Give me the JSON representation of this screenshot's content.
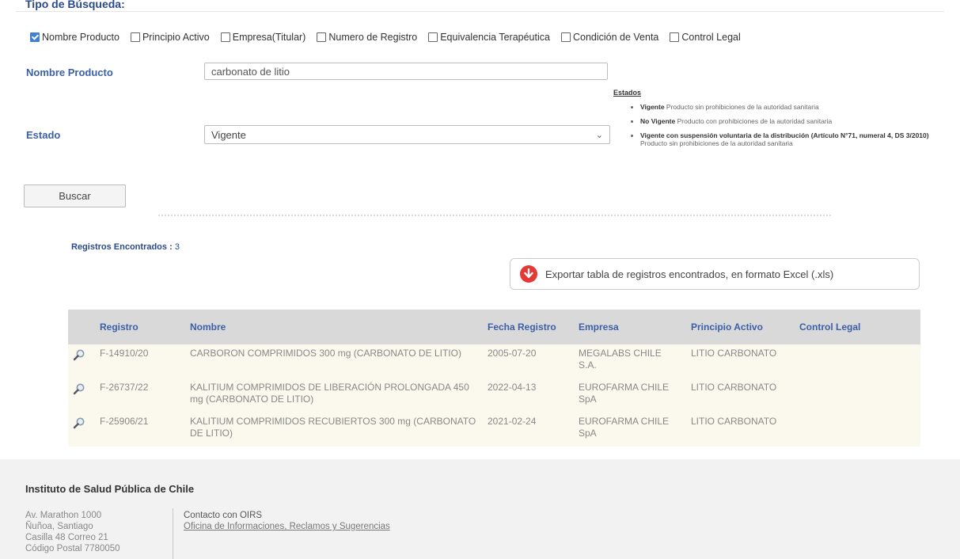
{
  "search_type_title": "Tipo de Búsqueda:",
  "checkboxes": [
    {
      "label": "Nombre Producto",
      "checked": true
    },
    {
      "label": "Principio Activo",
      "checked": false
    },
    {
      "label": "Empresa(Titular)",
      "checked": false
    },
    {
      "label": "Numero de Registro",
      "checked": false
    },
    {
      "label": "Equivalencia Terapéutica",
      "checked": false
    },
    {
      "label": "Condición de Venta",
      "checked": false
    },
    {
      "label": "Control Legal",
      "checked": false
    }
  ],
  "product_name": {
    "label": "Nombre Producto",
    "value": "carbonato de litio"
  },
  "estado": {
    "label": "Estado",
    "selected": "Vigente"
  },
  "estados_legend": {
    "title": "Estados",
    "items": [
      {
        "term": "Vigente",
        "desc": "Producto sin prohibiciones de la autoridad sanitaria"
      },
      {
        "term": "No Vigente",
        "desc": "Producto con prohibiciones de la autoridad sanitaria"
      },
      {
        "term": "Vigente con suspensión voluntaria de la distribución (Artículo N°71, numeral 4, DS 3/2010)",
        "desc": "Producto sin prohibiciones de la autoridad sanitaria"
      }
    ]
  },
  "search_button": "Buscar",
  "records": {
    "label": "Registros Encontrados :",
    "count": "3"
  },
  "export_label": "Exportar tabla de registros encontrados, en formato Excel (.xls)",
  "table": {
    "headers": [
      "Registro",
      "Nombre",
      "Fecha Registro",
      "Empresa",
      "Principio Activo",
      "Control Legal"
    ],
    "rows": [
      {
        "registro": "F-14910/20",
        "nombre": "CARBORON COMPRIMIDOS 300 mg (CARBONATO DE LITIO)",
        "fecha": "2005-07-20",
        "empresa": "MEGALABS CHILE S.A.",
        "principio": "LITIO CARBONATO",
        "control": ""
      },
      {
        "registro": "F-26737/22",
        "nombre": "KALITIUM COMPRIMIDOS DE LIBERACIÓN PROLONGADA 450 mg (CARBONATO DE LITIO)",
        "fecha": "2022-04-13",
        "empresa": "EUROFARMA CHILE SpA",
        "principio": "LITIO CARBONATO",
        "control": ""
      },
      {
        "registro": "F-25906/21",
        "nombre": "KALITIUM COMPRIMIDOS RECUBIERTOS 300 mg (CARBONATO DE LITIO)",
        "fecha": "2021-02-24",
        "empresa": "EUROFARMA CHILE SpA",
        "principio": "LITIO CARBONATO",
        "control": ""
      }
    ]
  },
  "footer": {
    "title": "Instituto de Salud Pública de Chile",
    "address": [
      "Av. Marathon 1000",
      "Ñuñoa, Santiago",
      "Casilla 48 Correo 21",
      "Código Postal 7780050"
    ],
    "contact_title": "Contacto con OIRS",
    "contact_link": "Oficina de Informaciones, Reclamos y Sugerencias"
  }
}
